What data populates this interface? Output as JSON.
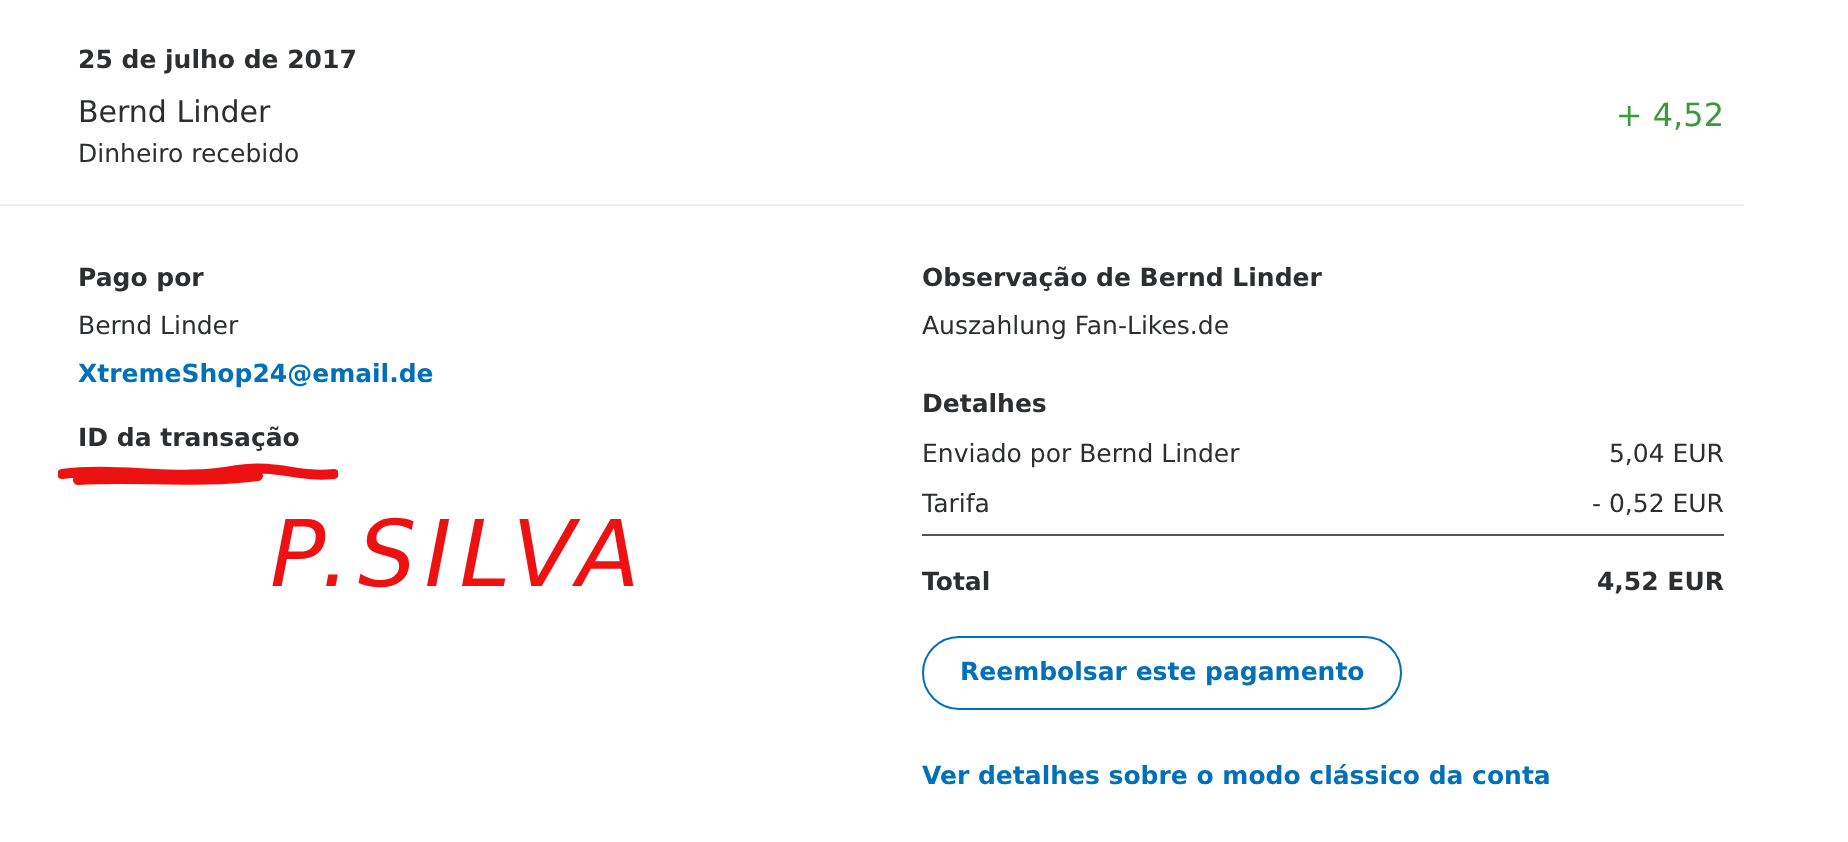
{
  "header": {
    "date": "25 de julho de 2017",
    "name": "Bernd Linder",
    "type": "Dinheiro recebido",
    "amount": "+ 4,52"
  },
  "paid_by": {
    "heading": "Pago por",
    "name": "Bernd Linder",
    "email": "XtremeShop24@email.de"
  },
  "transaction_id": {
    "heading": "ID da transação"
  },
  "handwritten_note": "P.SILVA",
  "note": {
    "heading": "Observação de Bernd Linder",
    "text": "Auszahlung Fan-Likes.de"
  },
  "details": {
    "heading": "Detalhes",
    "rows": [
      {
        "label": "Enviado por Bernd Linder",
        "value": "5,04 EUR"
      },
      {
        "label": "Tarifa",
        "value": "- 0,52 EUR"
      }
    ],
    "total": {
      "label": "Total",
      "value": "4,52 EUR"
    }
  },
  "refund_button": "Reembolsar este pagamento",
  "classic_link": "Ver detalhes sobre o modo clássico da conta"
}
